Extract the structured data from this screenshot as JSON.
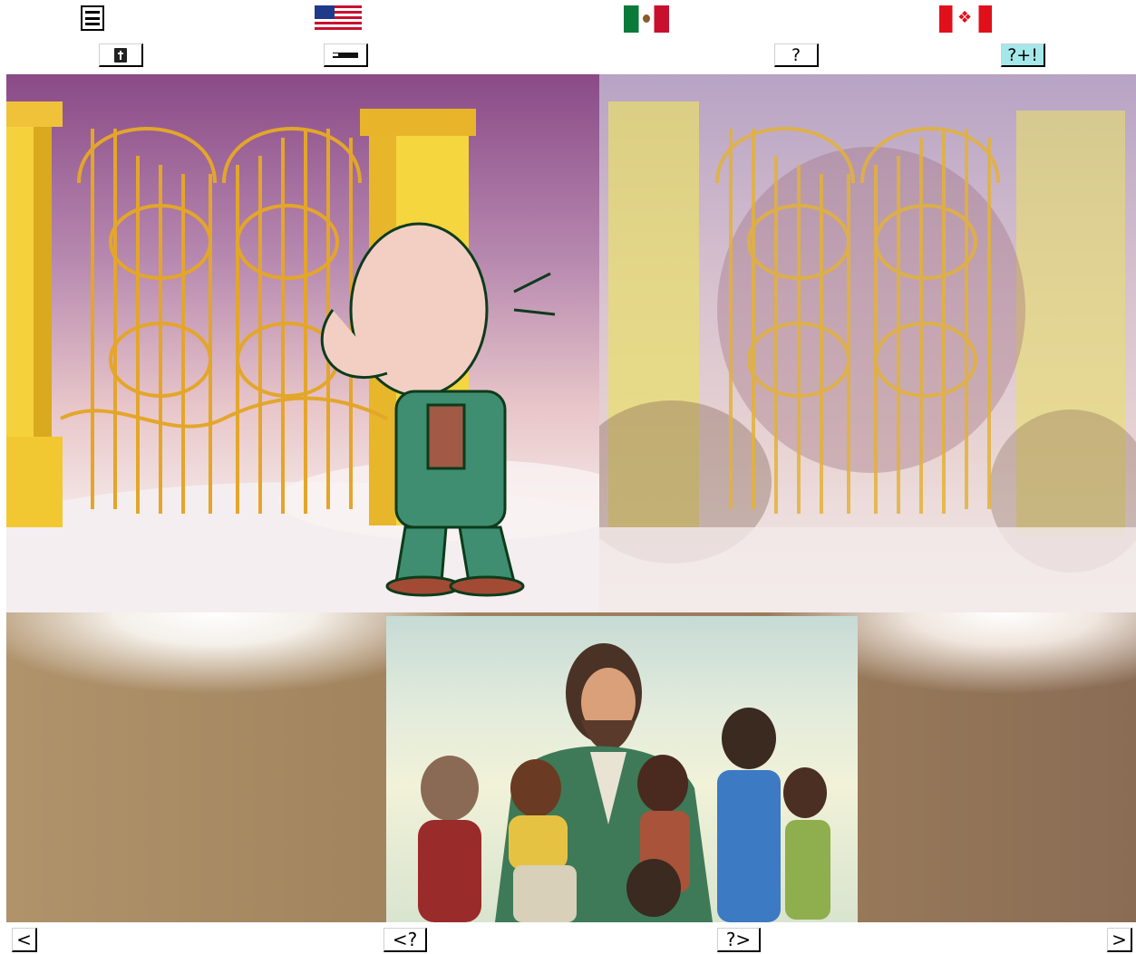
{
  "header": {
    "menu_icon": "hamburger-menu-icon",
    "flags": [
      "united-states-flag",
      "mexico-flag",
      "canada-flag"
    ]
  },
  "toolbar": {
    "bible_icon": "bible-icon",
    "graduation_icon": "graduation-cap-icon",
    "question_label": "?",
    "question_plus_label": "?+!"
  },
  "scene": {
    "left_image": "golden-gates-with-cartoon-old-man",
    "right_image": "golden-gates-blended-with-jesus-and-children",
    "center_image": "jesus-with-children"
  },
  "navigation": {
    "prev_label": "<",
    "prev_question_label": "<?",
    "next_question_label": "?>",
    "next_label": ">"
  }
}
